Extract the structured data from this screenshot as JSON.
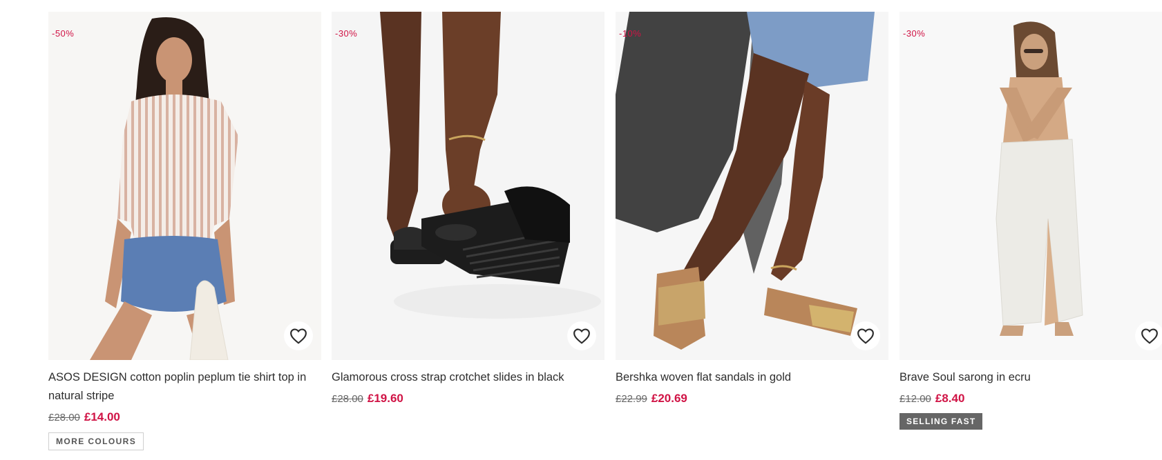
{
  "products": [
    {
      "discount": "-50%",
      "title": "ASOS DESIGN cotton poplin peplum tie shirt top in natural stripe",
      "was_price": "£28.00",
      "now_price": "£14.00",
      "badge": "MORE COLOURS",
      "save_icon": "heart-icon"
    },
    {
      "discount": "-30%",
      "title": "Glamorous cross strap crotchet slides in black",
      "was_price": "£28.00",
      "now_price": "£19.60",
      "save_icon": "heart-icon"
    },
    {
      "discount": "-10%",
      "title": "Bershka woven flat sandals in gold",
      "was_price": "£22.99",
      "now_price": "£20.69",
      "save_icon": "heart-icon"
    },
    {
      "discount": "-30%",
      "title": "Brave Soul sarong in ecru",
      "was_price": "£12.00",
      "now_price": "£8.40",
      "badge": "SELLING FAST",
      "save_icon": "heart-icon"
    }
  ],
  "colors": {
    "sale": "#d01345",
    "text": "#2d2d2d",
    "was_price": "#666666",
    "selling_fast_bg": "#666666"
  }
}
